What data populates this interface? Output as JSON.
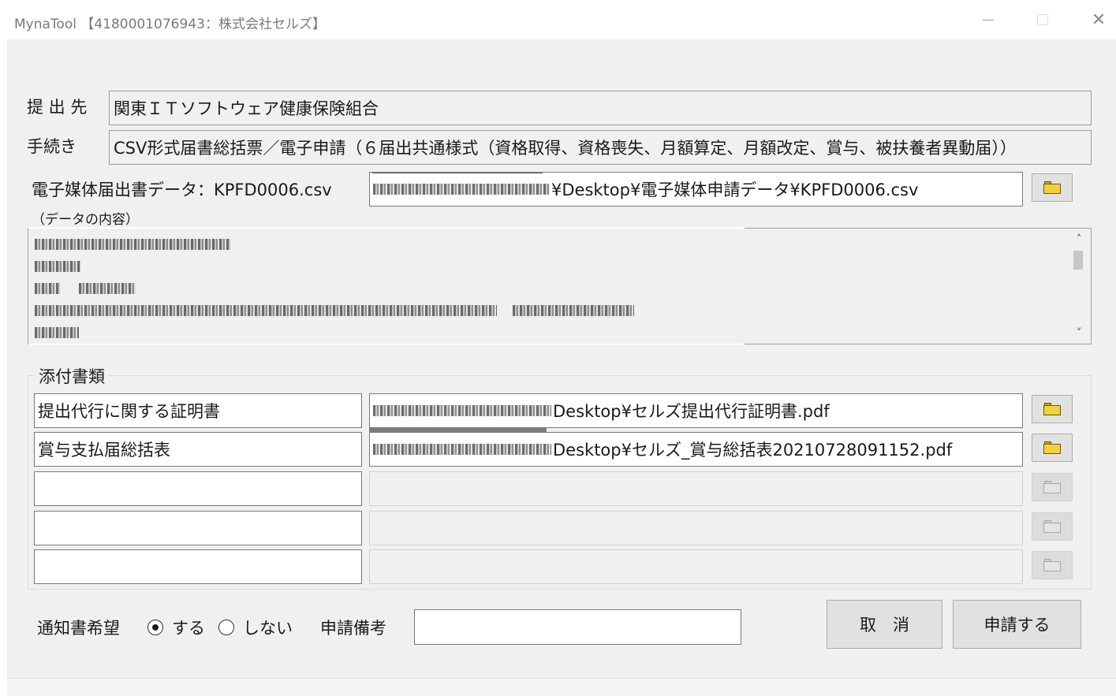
{
  "window": {
    "title": "MynaTool 【4180001076943：株式会社セルズ】",
    "close_glyph": "✕"
  },
  "form": {
    "submit_to_label": "提 出 先",
    "submit_to_value": "関東ＩＴソフトウェア健康保険組合",
    "procedure_label": "手続き",
    "procedure_value": "CSV形式届書総括票／電子申請（６届出共通様式（資格取得、資格喪失、月額算定、月額改定、賞与、被扶養者異動届））",
    "media_label": "電子媒体届出書データ：KPFD0006.csv",
    "media_path": "¥Desktop¥電子媒体申請データ¥KPFD0006.csv",
    "content_label": "（データの内容）"
  },
  "attachments": {
    "legend": "添付書類",
    "rows": [
      {
        "name": "提出代行に関する証明書",
        "path": "Desktop¥セルズ提出代行証明書.pdf"
      },
      {
        "name": "賞与支払届総括表",
        "path": "Desktop¥セルズ_賞与総括表20210728091152.pdf"
      },
      {
        "name": "",
        "path": ""
      },
      {
        "name": "",
        "path": ""
      },
      {
        "name": "",
        "path": ""
      }
    ]
  },
  "footer": {
    "notice_label": "通知書希望",
    "opt_yes": "する",
    "opt_no": "しない",
    "notice_selected": "する",
    "remarks_label": "申請備考",
    "remarks_value": "",
    "cancel_label": "取　消",
    "apply_label": "申請する"
  },
  "icons": {
    "folder": "folder-icon",
    "scroll_up": "˄",
    "scroll_down": "˅"
  }
}
